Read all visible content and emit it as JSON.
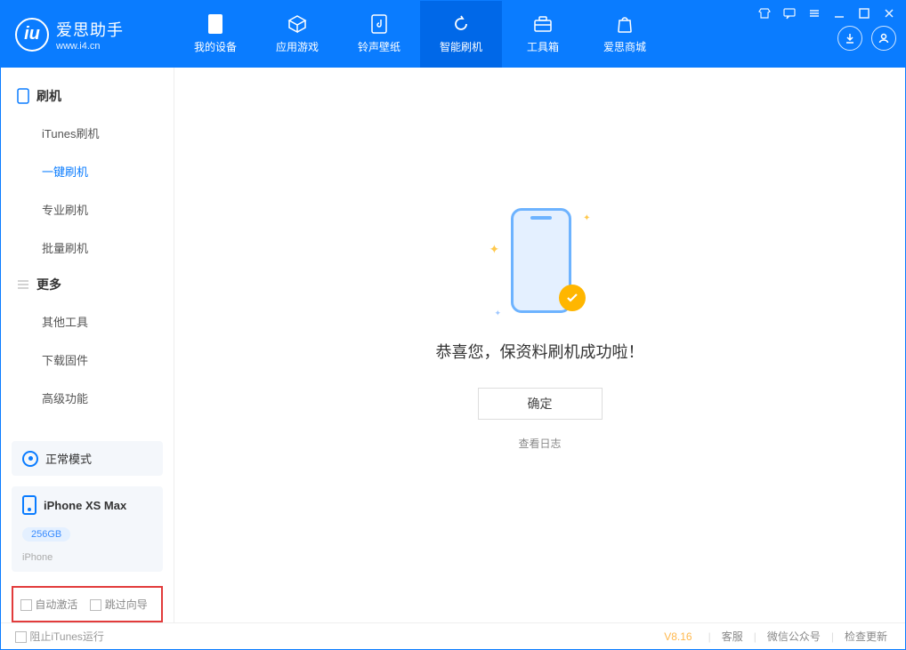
{
  "logo": {
    "title": "爱思助手",
    "subtitle": "www.i4.cn",
    "glyph": "iu"
  },
  "nav": {
    "items": [
      {
        "label": "我的设备",
        "icon": "device"
      },
      {
        "label": "应用游戏",
        "icon": "cube"
      },
      {
        "label": "铃声壁纸",
        "icon": "music"
      },
      {
        "label": "智能刷机",
        "icon": "refresh"
      },
      {
        "label": "工具箱",
        "icon": "toolbox"
      },
      {
        "label": "爱思商城",
        "icon": "bag"
      }
    ]
  },
  "sidebar": {
    "section1": {
      "title": "刷机",
      "items": [
        "iTunes刷机",
        "一键刷机",
        "专业刷机",
        "批量刷机"
      ]
    },
    "section2": {
      "title": "更多",
      "items": [
        "其他工具",
        "下载固件",
        "高级功能"
      ]
    },
    "status": {
      "label": "正常模式"
    },
    "device": {
      "name": "iPhone XS Max",
      "capacity": "256GB",
      "type": "iPhone"
    },
    "options": {
      "auto_activate": "自动激活",
      "skip_setup": "跳过向导"
    }
  },
  "main": {
    "success_msg": "恭喜您，保资料刷机成功啦！",
    "ok": "确定",
    "view_log": "查看日志"
  },
  "footer": {
    "block_itunes": "阻止iTunes运行",
    "version": "V8.16",
    "links": [
      "客服",
      "微信公众号",
      "检查更新"
    ]
  }
}
